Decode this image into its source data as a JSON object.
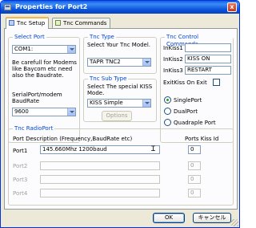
{
  "window": {
    "title": "Properties for Port2",
    "close_symbol": "x"
  },
  "tabs": [
    {
      "label": "Tnc Setup",
      "icon": "setup-icon",
      "active": true
    },
    {
      "label": "Tnc Commands",
      "icon": "commands-icon",
      "active": false
    }
  ],
  "select_port": {
    "title": "Select Port",
    "value": "COM1:",
    "note": "Be carefull for Modems like Baycom etc need also the Baudrate.",
    "baud_label": "SerialPort/modem BaudRate",
    "baud_value": "9600"
  },
  "tnc_type": {
    "title": "Tnc Type",
    "prompt": "Select Your Tnc Model.",
    "value": "TAPR TNC2"
  },
  "tnc_sub_type": {
    "title": "Tnc Sub Type",
    "prompt": "Select The special KISS Mode.",
    "value": "KISS Simple",
    "options_button": "Options"
  },
  "tnc_control": {
    "title": "Tnc Control Commands",
    "rows": [
      {
        "label": "InKiss1",
        "value": ""
      },
      {
        "label": "InKiss2",
        "value": "KISS ON"
      },
      {
        "label": "InKiss3",
        "value": "RESTART"
      }
    ],
    "exit_label": "ExitKiss On Exit",
    "exit_checked": false,
    "port_modes": [
      {
        "label": "SinglePort",
        "selected": true
      },
      {
        "label": "DualPort",
        "selected": false
      },
      {
        "label": "Quadraple Port",
        "selected": false
      }
    ]
  },
  "radio_port": {
    "title": "Tnc RadioPort",
    "description_header": "Port Description (Frequency,BaudRate etc)",
    "kiss_header": "Ports Kiss Id",
    "ports": [
      {
        "label": "Port1",
        "description": "145.660Mhz 1200baud",
        "kiss_id": "0",
        "enabled": true
      },
      {
        "label": "Port2",
        "description": "",
        "kiss_id": "0",
        "enabled": false
      },
      {
        "label": "Port3",
        "description": "",
        "kiss_id": "0",
        "enabled": false
      },
      {
        "label": "Port4",
        "description": "",
        "kiss_id": "0",
        "enabled": false
      }
    ]
  },
  "footer": {
    "ok": "OK",
    "cancel": "キャンセル"
  },
  "colors": {
    "group_title": "#0046d5",
    "titlebar": "#0a53da",
    "tab_highlight": "#f7b543"
  }
}
